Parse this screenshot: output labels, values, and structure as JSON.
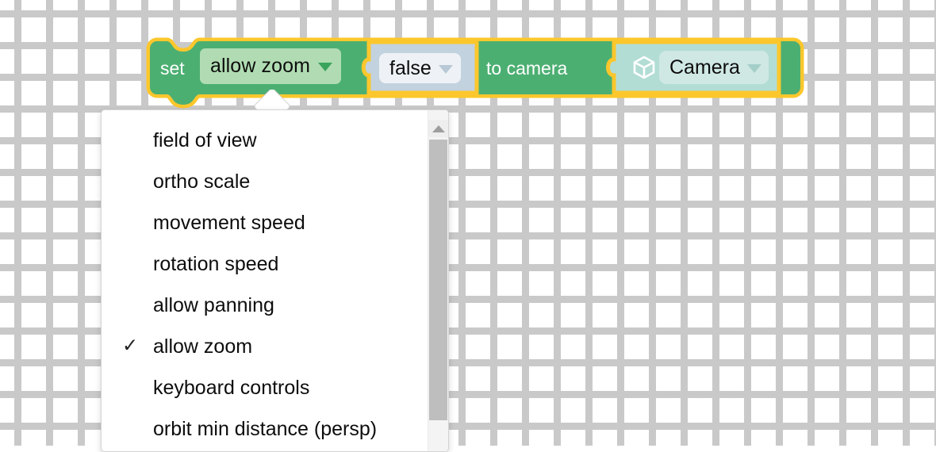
{
  "canvas": {
    "background_color": "#ffffff",
    "grid_mark": "plus-mark",
    "grid_color": "#c9c9c9",
    "grid_spacing": 40
  },
  "block": {
    "kind": "set-property-block",
    "highlight_color": "#fcc72c",
    "body_color": "#4caf72",
    "set_label": "set",
    "to_label": "to camera",
    "property_field": {
      "value": "allow zoom",
      "field_color": "#b1dcb3",
      "arrow": "chevron-down-icon"
    },
    "value_field": {
      "value": "false",
      "block_color": "#c2d2de",
      "field_color": "#eef2f6",
      "arrow": "chevron-down-icon"
    },
    "target_field": {
      "value": "Camera",
      "icon": "cube-icon",
      "block_color": "#b2ddd5",
      "field_color": "#cfe8e3",
      "arrow": "chevron-down-icon"
    }
  },
  "dropdown": {
    "selected": "allow zoom",
    "check_glyph": "✓",
    "items": [
      {
        "label": "field of view",
        "checked": false
      },
      {
        "label": "ortho scale",
        "checked": false
      },
      {
        "label": "movement speed",
        "checked": false
      },
      {
        "label": "rotation speed",
        "checked": false
      },
      {
        "label": "allow panning",
        "checked": false
      },
      {
        "label": "allow zoom",
        "checked": true
      },
      {
        "label": "keyboard controls",
        "checked": false
      },
      {
        "label": "orbit min distance (persp)",
        "checked": false
      }
    ],
    "scrollbar": {
      "up_arrow": "scroll-up-icon",
      "thumb_color": "#bebebe",
      "track_color": "#f4f4f4"
    }
  }
}
